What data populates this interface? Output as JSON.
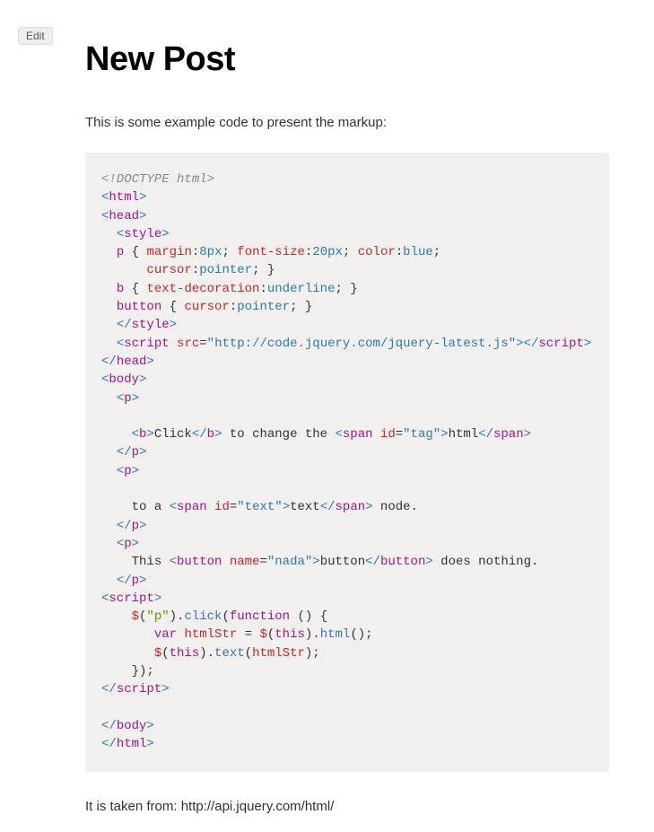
{
  "edit_button": "Edit",
  "title": "New Post",
  "intro": "This is some example code to present the markup:",
  "footer": "It is taken from: http://api.jquery.com/html/",
  "code": {
    "l1_doctype": "<!DOCTYPE html>",
    "l2_open": "<",
    "l2_tag": "html",
    "l2_close": ">",
    "l3_open": "<",
    "l3_tag": "head",
    "l3_close": ">",
    "l4_open": "<",
    "l4_tag": "style",
    "l4_close": ">",
    "l5_sel": "p",
    "l5_b1": " { ",
    "l5_p1": "margin",
    "l5_c1": ":",
    "l5_v1": "8px",
    "l5_s1": "; ",
    "l5_p2": "font-size",
    "l5_c2": ":",
    "l5_v2": "20px",
    "l5_s2": "; ",
    "l5_p3": "color",
    "l5_c3": ":",
    "l5_v3": "blue",
    "l5_s3": ";",
    "l6_p1": "cursor",
    "l6_c1": ":",
    "l6_v1": "pointer",
    "l6_s1": "; }",
    "l7_sel": "b",
    "l7_b1": " { ",
    "l7_p1": "text-decoration",
    "l7_c1": ":",
    "l7_v1": "underline",
    "l7_s1": "; }",
    "l8_sel": "button",
    "l8_b1": " { ",
    "l8_p1": "cursor",
    "l8_c1": ":",
    "l8_v1": "pointer",
    "l8_s1": "; }",
    "l9_open": "</",
    "l9_tag": "style",
    "l9_close": ">",
    "l10_open": "<",
    "l10_tag": "script",
    "l10_sp": " ",
    "l10_attr": "src",
    "l10_eq": "=",
    "l10_q1": "\"",
    "l10_val": "http://code.jquery.com/jquery-latest.js",
    "l10_q2": "\"",
    "l10_close": ">",
    "l10_copen": "</",
    "l10_ctag": "script",
    "l10_cclose": ">",
    "l11_open": "</",
    "l11_tag": "head",
    "l11_close": ">",
    "l12_open": "<",
    "l12_tag": "body",
    "l12_close": ">",
    "l13_open": "<",
    "l13_tag": "p",
    "l13_close": ">",
    "l15_bopen": "<",
    "l15_btag": "b",
    "l15_bclose": ">",
    "l15_btxt": "Click",
    "l15_bcopen": "</",
    "l15_bctag": "b",
    "l15_bcclose": ">",
    "l15_txt1": " to change the ",
    "l15_sopen": "<",
    "l15_stag": "span",
    "l15_sp": " ",
    "l15_sattr": "id",
    "l15_seq": "=",
    "l15_sq1": "\"",
    "l15_sval": "tag",
    "l15_sq2": "\"",
    "l15_sclose": ">",
    "l15_stxt": "html",
    "l15_scopen": "</",
    "l15_sctag": "span",
    "l15_scclose": ">",
    "l16_open": "</",
    "l16_tag": "p",
    "l16_close": ">",
    "l17_open": "<",
    "l17_tag": "p",
    "l17_close": ">",
    "l19_txt1": "to a ",
    "l19_sopen": "<",
    "l19_stag": "span",
    "l19_sp": " ",
    "l19_sattr": "id",
    "l19_seq": "=",
    "l19_sq1": "\"",
    "l19_sval": "text",
    "l19_sq2": "\"",
    "l19_sclose": ">",
    "l19_stxt": "text",
    "l19_scopen": "</",
    "l19_sctag": "span",
    "l19_scclose": ">",
    "l19_txt2": " node.",
    "l20_open": "</",
    "l20_tag": "p",
    "l20_close": ">",
    "l21_open": "<",
    "l21_tag": "p",
    "l21_close": ">",
    "l22_txt1": "This ",
    "l22_bopen": "<",
    "l22_btag": "button",
    "l22_sp": " ",
    "l22_battr": "name",
    "l22_beq": "=",
    "l22_bq1": "\"",
    "l22_bval": "nada",
    "l22_bq2": "\"",
    "l22_bclose": ">",
    "l22_btxt": "button",
    "l22_bcopen": "</",
    "l22_bctag": "button",
    "l22_bcclose": ">",
    "l22_txt2": " does nothing.",
    "l23_open": "</",
    "l23_tag": "p",
    "l23_close": ">",
    "l24_open": "<",
    "l24_tag": "script",
    "l24_close": ">",
    "l25_jq": "$",
    "l25_p1": "(",
    "l25_str": "\"p\"",
    "l25_p2": ").",
    "l25_fn": "click",
    "l25_p3": "(",
    "l25_kw": "function",
    "l25_p4": " () {",
    "l26_kw": "var",
    "l26_sp": " ",
    "l26_var": "htmlStr",
    "l26_eq": " = ",
    "l26_jq": "$",
    "l26_p1": "(",
    "l26_this": "this",
    "l26_p2": ").",
    "l26_fn": "html",
    "l26_p3": "();",
    "l27_jq": "$",
    "l27_p1": "(",
    "l27_this": "this",
    "l27_p2": ").",
    "l27_fn": "text",
    "l27_p3": "(",
    "l27_var": "htmlStr",
    "l27_p4": ");",
    "l28_close": "});",
    "l29_open": "</",
    "l29_tag": "script",
    "l29_close": ">",
    "l31_open": "</",
    "l31_tag": "body",
    "l31_close": ">",
    "l32_open": "</",
    "l32_tag": "html",
    "l32_close": ">"
  }
}
